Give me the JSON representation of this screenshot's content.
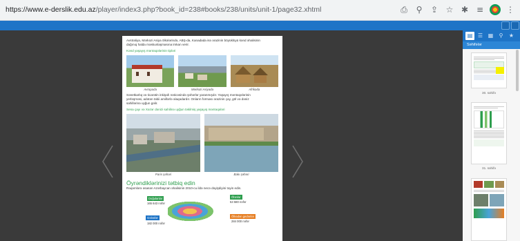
{
  "browser": {
    "url_host": "https://www.e-derslik.edu.az",
    "url_path": "/player/index3.php?book_id=238#books/238/units/unit-1/page32.xhtml",
    "icons": [
      "translate-icon",
      "zoom-icon",
      "share-icon",
      "star-icon",
      "extensions-icon",
      "reading-list-icon",
      "profile-icon",
      "menu-icon"
    ]
  },
  "page": {
    "intro_lines": [
      "Avstraliya, Mərkəzi Asiya ölkələrində, ABŞ-da, Kanadada isə ərazinin böyüklüyü kənd əhalisinin",
      "dağınıq halda məskunlaşmasına imkan verir."
    ],
    "heading_rural": "Kənd yaşayış məntəqələrinin tipləri",
    "captions_row1": [
      "Avropada",
      "Mərkəzi Asiyada",
      "Afrikada"
    ],
    "middle_lines": [
      "Sənetkarlıq və ticarətin inkişafı nəticəsində şəhərlər yaranmışdır. Yaşayış məntəqələrinin",
      "yerləşməsi, adətən təbii amillərlə əlaqədardır. Onların forması ərazinin çay, göl və dəniz",
      "sahillərinə uyğun gəlir."
    ],
    "heading_coast": "Sena çayı və Xəzər dənizi sahilinə uyğun təkilmiş yaşayış məntəqələri",
    "captions_row2": [
      "Paris şəhəri",
      "Bakı şəhəri"
    ],
    "section_title": "Öyrəndiklərinizi tətbiq edin",
    "task_line": "Rəqəmlərə əsasən Azərbaycan əhalisinin 2010-cu ildə necə dəyişdiyini təyin edin.",
    "infographic": {
      "labels": [
        "Doğulanlar",
        "Ölənlər",
        "Gələnlər",
        "Ölkədən gedənlər"
      ],
      "values": [
        "165 643 nəfər",
        "53 580 nəfər",
        "182 000 nəfər",
        "284 000 nəfər"
      ],
      "colors": [
        "#2e9e4e",
        "#2e9e4e",
        "#1e74c7",
        "#e67e22"
      ]
    }
  },
  "sidebar": {
    "title": "Səhifələr",
    "tabs": [
      "pages-icon",
      "list-icon",
      "grid-icon",
      "search-icon",
      "bookmark-icon"
    ],
    "thumb_labels": [
      "30. səhifə",
      "31. səhifə"
    ]
  },
  "colors": {
    "accent": "#1e74c7",
    "green": "#2e9e4e",
    "reader_bg": "#3a3a3a"
  }
}
